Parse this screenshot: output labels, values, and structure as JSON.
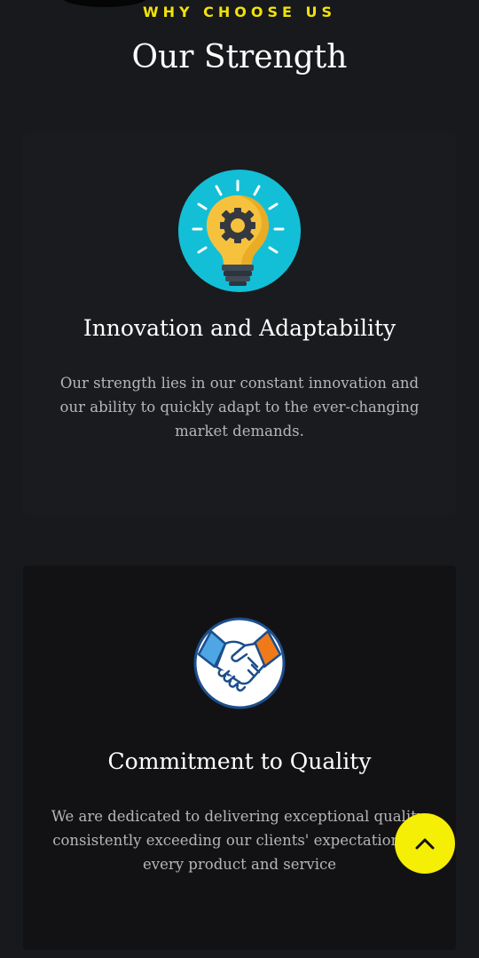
{
  "section": {
    "eyebrow": "WHY CHOOSE US",
    "title": "Our Strength"
  },
  "cards": [
    {
      "icon": "lightbulb-gear-icon",
      "title": "Innovation and Adaptability",
      "text": "Our strength lies in our constant innovation and our ability to quickly adapt to the ever-changing market demands."
    },
    {
      "icon": "handshake-icon",
      "title": "Commitment to Quality",
      "text": "We are dedicated to delivering exceptional quality, consistently exceeding our clients' expectations in every product and service"
    }
  ],
  "scroll_top": {
    "icon": "chevron-up-icon"
  },
  "colors": {
    "background": "#17191c",
    "accent": "#f5ee05",
    "eyebrow": "#f2e20a"
  }
}
